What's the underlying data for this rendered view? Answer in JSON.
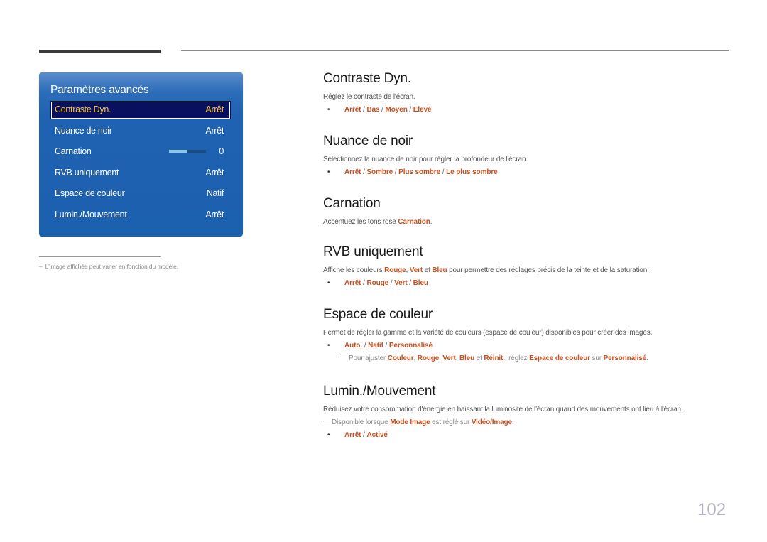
{
  "page_number": "102",
  "osd": {
    "title": "Paramètres avancés",
    "items": [
      {
        "label": "Contraste Dyn.",
        "value": "Arrêt",
        "selected": true
      },
      {
        "label": "Nuance de noir",
        "value": "Arrêt"
      },
      {
        "label": "Carnation",
        "value": "0",
        "slider_fraction": 0.5
      },
      {
        "label": "RVB uniquement",
        "value": "Arrêt"
      },
      {
        "label": "Espace de couleur",
        "value": "Natif"
      },
      {
        "label": "Lumin./Mouvement",
        "value": "Arrêt"
      }
    ]
  },
  "footnote": {
    "dash": "–",
    "text": "L'image affichée peut varier en fonction du modèle."
  },
  "colors": {
    "highlight": "#c8501f",
    "panel_blue": "#1f62b1",
    "selected_bg": "#0a1060",
    "selected_text": "#f6c12c"
  },
  "bullet": "•",
  "slash": " / ",
  "sections": {
    "contraste": {
      "title": "Contraste Dyn.",
      "desc": "Réglez le contraste de l'écran.",
      "options": [
        "Arrêt",
        "Bas",
        "Moyen",
        "Elevé"
      ]
    },
    "nuance": {
      "title": "Nuance de noir",
      "desc": "Sélectionnez la nuance de noir pour régler la profondeur de l'écran.",
      "options": [
        "Arrêt",
        "Sombre",
        "Plus sombre",
        "Le plus sombre"
      ]
    },
    "carnation": {
      "title": "Carnation",
      "desc_pre": "Accentuez les tons rose ",
      "desc_hl": "Carnation",
      "desc_post": "."
    },
    "rvb": {
      "title": "RVB uniquement",
      "desc_pre": "Affiche les couleurs ",
      "hl1": "Rouge",
      "t1": ", ",
      "hl2": "Vert",
      "t2": " et ",
      "hl3": "Bleu",
      "desc_post": " pour permettre des réglages précis de la teinte et de la saturation.",
      "options": [
        "Arrêt",
        "Rouge",
        "Vert",
        "Bleu"
      ]
    },
    "espace": {
      "title": "Espace de couleur",
      "desc": "Permet de régler la gamme et la variété de couleurs (espace de couleur) disponibles pour créer des images.",
      "options": [
        "Auto.",
        "Natif",
        "Personnalisé"
      ],
      "note": {
        "pre": "Pour ajuster ",
        "hl1": "Couleur",
        "t1": ", ",
        "hl2": "Rouge",
        "t2": ", ",
        "hl3": "Vert",
        "t3": ", ",
        "hl4": "Bleu",
        "t4": " et ",
        "hl5": "Réinit.",
        "t5": ", réglez ",
        "hl6": "Espace de couleur",
        "t6": " sur ",
        "hl7": "Personnalisé",
        "post": "."
      }
    },
    "lumin": {
      "title": "Lumin./Mouvement",
      "desc": "Réduisez votre consommation d'énergie en baissant la luminosité de l'écran quand des mouvements ont lieu à l'écran.",
      "note": {
        "pre": "Disponible lorsque ",
        "hl1": "Mode Image",
        "t1": " est réglé sur ",
        "hl2": "Vidéo/Image",
        "post": "."
      },
      "options": [
        "Arrêt",
        "Activé"
      ]
    }
  }
}
